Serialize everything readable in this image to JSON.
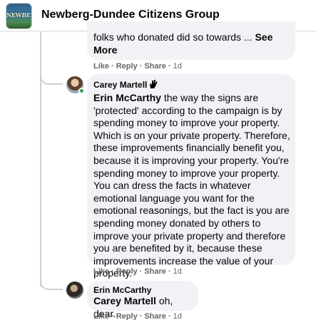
{
  "header": {
    "group_title": "Newberg-Dundee Citizens Group",
    "thumb_text": "NEWBERG"
  },
  "comments": [
    {
      "text_prefix": "folks who donated did so towards ...",
      "see_more": "See More",
      "actions": {
        "like": "Like",
        "reply": "Reply",
        "share": "Share",
        "time": "1d"
      }
    },
    {
      "author": "Carey Martell",
      "badge_icon": "hand-wave-icon",
      "mention": "Erin McCarthy",
      "text": "the way the signs are 'protected' according to the campaign is by spending money to improve your property. Which is on your private property. Therefore, these improvements financially benefit you, because it is improving your property. You're spending money to improve your property. You can dress the facts in whatever emotional language you want for the emotional reasonings, but the fact is you are spending money donated by others to improve your private property and therefore you are benefited by it, because these improvements increase the value of your property.",
      "actions": {
        "like": "Like",
        "reply": "Reply",
        "share": "Share",
        "time": "1d"
      }
    },
    {
      "author": "Erin McCarthy",
      "mention": "Carey Martell",
      "text": "oh, dear.",
      "actions": {
        "like": "Like",
        "reply": "Reply",
        "share": "Share",
        "time": "1d"
      }
    }
  ],
  "colors": {
    "bubble": "#f0f2f5",
    "meta_text": "#65676b",
    "online": "#31a24c"
  },
  "separator": "·"
}
